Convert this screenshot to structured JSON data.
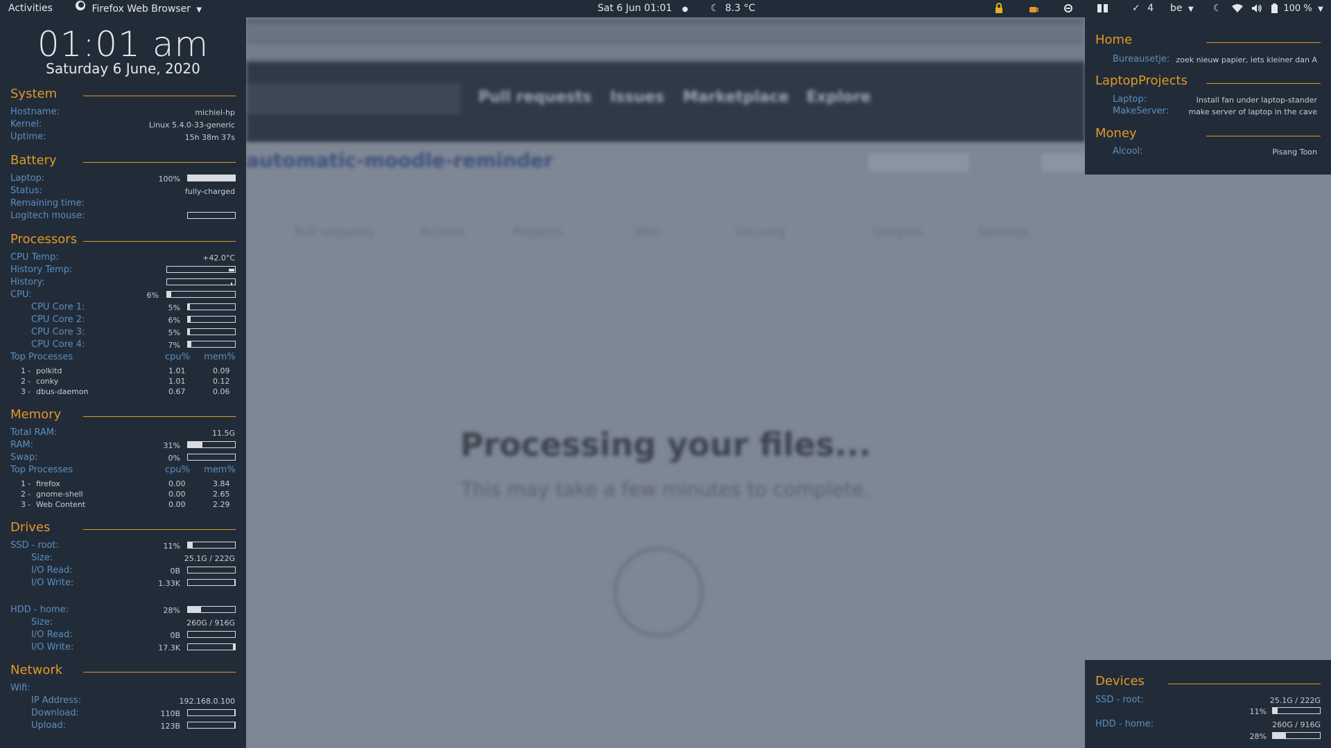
{
  "topbar": {
    "activities": "Activities",
    "app_name": "Firefox Web Browser",
    "clock": "Sat 6 Jun  01:01",
    "weather": "8.3 °C",
    "todo_count": "4",
    "keyboard_layout": "be",
    "battery": "100 %"
  },
  "background": {
    "nav": [
      "Pull requests",
      "Issues",
      "Marketplace",
      "Explore"
    ],
    "repo": "automatic-moodle-reminder",
    "tabs": [
      "Pull requests",
      "Actions",
      "Projects",
      "Wiki",
      "Security",
      "Insights",
      "Settings"
    ],
    "title": "Processing your files...",
    "subtitle": "This may take a few minutes to complete."
  },
  "left": {
    "clock": "01:01 am",
    "date": "Saturday  6 June, 2020",
    "system": {
      "title": "System",
      "hostname_label": "Hostname:",
      "hostname": "michiel-hp",
      "kernel_label": "Kernel:",
      "kernel": "Linux 5.4.0-33-generic",
      "uptime_label": "Uptime:",
      "uptime": "15h 38m 37s"
    },
    "battery": {
      "title": "Battery",
      "laptop_label": "Laptop:",
      "laptop_pct": "100%",
      "laptop_fill": 1.0,
      "status_label": "Status:",
      "status": "fully-charged",
      "remaining_label": "Remaining time:",
      "mouse_label": "Logitech mouse:",
      "mouse_fill": 0.0
    },
    "processors": {
      "title": "Processors",
      "cpu_temp_label": "CPU Temp:",
      "cpu_temp": "+42.0°C",
      "history_temp_label": "History Temp:",
      "history_label": "History:",
      "cpu_label": "CPU:",
      "cpu_pct": "6%",
      "cpu_fill": 0.06,
      "cores": [
        {
          "label": "CPU Core 1:",
          "pct": "5%",
          "fill": 0.05
        },
        {
          "label": "CPU Core 2:",
          "pct": "6%",
          "fill": 0.06
        },
        {
          "label": "CPU Core 3:",
          "pct": "5%",
          "fill": 0.05
        },
        {
          "label": "CPU Core 4:",
          "pct": "7%",
          "fill": 0.07
        }
      ],
      "top_label": "Top Processes",
      "cpu_col": "cpu%",
      "mem_col": "mem%",
      "top": [
        {
          "rank": "1",
          "name": "polkitd",
          "cpu": "1.01",
          "mem": "0.09"
        },
        {
          "rank": "2",
          "name": "conky",
          "cpu": "1.01",
          "mem": "0.12"
        },
        {
          "rank": "3",
          "name": "dbus-daemon",
          "cpu": "0.67",
          "mem": "0.06"
        }
      ]
    },
    "memory": {
      "title": "Memory",
      "total_label": "Total RAM:",
      "total": "11.5G",
      "ram_label": "RAM:",
      "ram_pct": "31%",
      "ram_fill": 0.31,
      "swap_label": "Swap:",
      "swap_pct": "0%",
      "swap_fill": 0.0,
      "top_label": "Top Processes",
      "cpu_col": "cpu%",
      "mem_col": "mem%",
      "top": [
        {
          "rank": "1",
          "name": "firefox",
          "cpu": "0.00",
          "mem": "3.84"
        },
        {
          "rank": "2",
          "name": "gnome-shell",
          "cpu": "0.00",
          "mem": "2.65"
        },
        {
          "rank": "3",
          "name": "Web Content",
          "cpu": "0.00",
          "mem": "2.29"
        }
      ]
    },
    "drives": {
      "title": "Drives",
      "ssd_label": "SSD - root:",
      "ssd_pct": "11%",
      "ssd_fill": 0.11,
      "ssd_size_label": "Size:",
      "ssd_size": "25.1G / 222G",
      "ssd_read_label": "I/O Read:",
      "ssd_read": "0B",
      "ssd_read_fill": 0.0,
      "ssd_write_label": "I/O Write:",
      "ssd_write": "1.33K",
      "ssd_write_fill": 0.02,
      "hdd_label": "HDD - home:",
      "hdd_pct": "28%",
      "hdd_fill": 0.28,
      "hdd_size_label": "Size:",
      "hdd_size": "260G / 916G",
      "hdd_read_label": "I/O Read:",
      "hdd_read": "0B",
      "hdd_read_fill": 0.0,
      "hdd_write_label": "I/O Write:",
      "hdd_write": "17.3K",
      "hdd_write_fill": 0.04
    },
    "network": {
      "title": "Network",
      "wifi_label": "Wifi:",
      "ip_label": "IP Address:",
      "ip": "192.168.0.100",
      "download_label": "Download:",
      "download": "110B",
      "download_fill": 0.02,
      "upload_label": "Upload:",
      "upload": "123B",
      "upload_fill": 0.02
    }
  },
  "right_top": {
    "home_title": "Home",
    "bureau_label": "Bureausetje:",
    "bureau_value": "zoek nieuw papier, iets kleiner dan A",
    "laptopprojects_title": "LaptopProjects",
    "laptop_label": "Laptop:",
    "laptop_value": "Install fan under laptop-stander",
    "makeserver_label": "MakeServer:",
    "makeserver_value": "make server of laptop in the cave",
    "money_title": "Money",
    "alcool_label": "Alcool:",
    "alcool_value": "Pisang Toon"
  },
  "right_bottom": {
    "devices_title": "Devices",
    "ssd_label": "SSD - root:",
    "ssd_size": "25.1G / 222G",
    "ssd_pct": "11%",
    "ssd_fill": 0.11,
    "hdd_label": "HDD - home:",
    "hdd_size": "260G / 916G",
    "hdd_pct": "28%",
    "hdd_fill": 0.28
  },
  "colors": {
    "panel": "#222c38",
    "accent": "#e39826",
    "label": "#5b8fc1",
    "value": "#c8ccd2"
  }
}
